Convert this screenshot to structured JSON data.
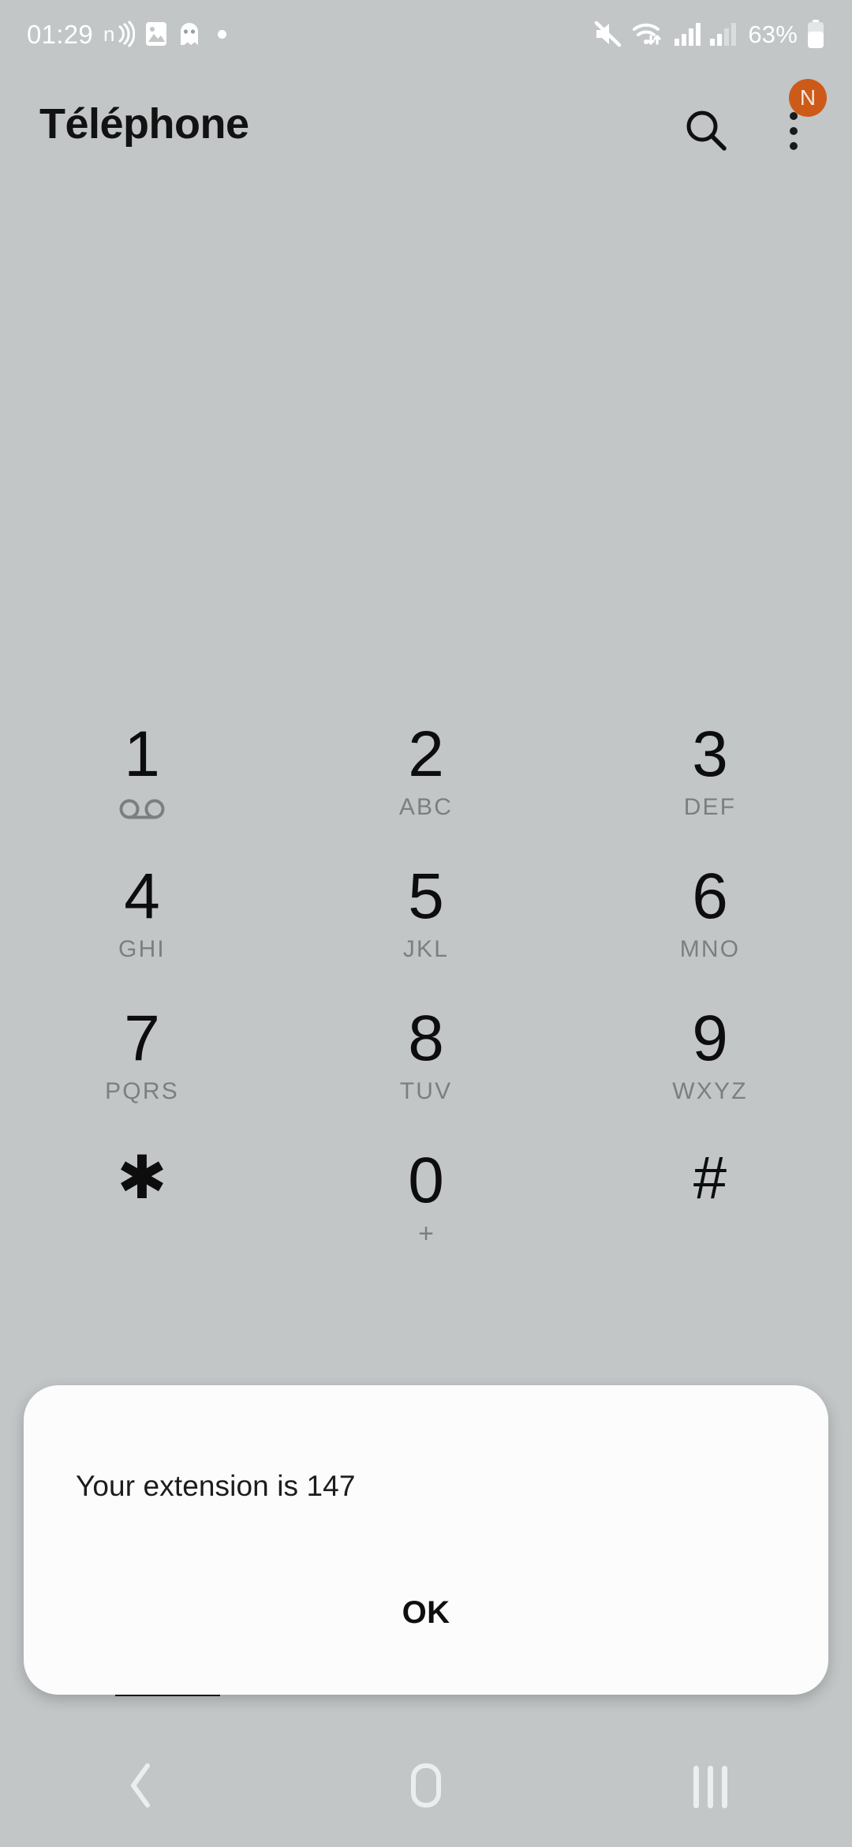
{
  "theme": {
    "background": "#c2c6c7",
    "dialog_background": "#fcfcfc",
    "accent_badge": "#cd5a18",
    "primary_text": "#0d0d0d",
    "secondary_text": "#7b7f80",
    "status_icon": "#ffffff"
  },
  "statusbar": {
    "time": "01:29",
    "left_icons": [
      {
        "name": "nfc-icon",
        "label": "n)"
      },
      {
        "name": "image-icon",
        "label": "image"
      },
      {
        "name": "ghost-app-icon",
        "label": "ghost"
      },
      {
        "name": "notification-dot-icon",
        "label": "dot"
      }
    ],
    "right_icons": [
      {
        "name": "mute-icon",
        "label": "mute"
      },
      {
        "name": "wifi-icon",
        "label": "wifi"
      },
      {
        "name": "signal-sim1-icon",
        "label": "signal1"
      },
      {
        "name": "signal-sim2-icon",
        "label": "signal2"
      }
    ],
    "battery_percent": "63%",
    "battery_level": 63
  },
  "appbar": {
    "title": "Téléphone",
    "search_icon": "search-icon",
    "more_icon": "more-vertical-icon",
    "avatar_letter": "N"
  },
  "keypad": {
    "rows": [
      [
        {
          "digit": "1",
          "sub": "",
          "icon": "voicemail-icon"
        },
        {
          "digit": "2",
          "sub": "ABC",
          "icon": ""
        },
        {
          "digit": "3",
          "sub": "DEF",
          "icon": ""
        }
      ],
      [
        {
          "digit": "4",
          "sub": "GHI",
          "icon": ""
        },
        {
          "digit": "5",
          "sub": "JKL",
          "icon": ""
        },
        {
          "digit": "6",
          "sub": "MNO",
          "icon": ""
        }
      ],
      [
        {
          "digit": "7",
          "sub": "PQRS",
          "icon": ""
        },
        {
          "digit": "8",
          "sub": "TUV",
          "icon": ""
        },
        {
          "digit": "9",
          "sub": "WXYZ",
          "icon": ""
        }
      ],
      [
        {
          "digit": "✱",
          "sub": "",
          "icon": ""
        },
        {
          "digit": "0",
          "sub": "+",
          "icon": ""
        },
        {
          "digit": "#",
          "sub": "",
          "icon": ""
        }
      ]
    ]
  },
  "dialog": {
    "message": "Your extension is 147",
    "ok_label": "OK"
  },
  "navbar": {
    "back": "back-icon",
    "home": "home-icon",
    "recents": "recents-icon"
  }
}
